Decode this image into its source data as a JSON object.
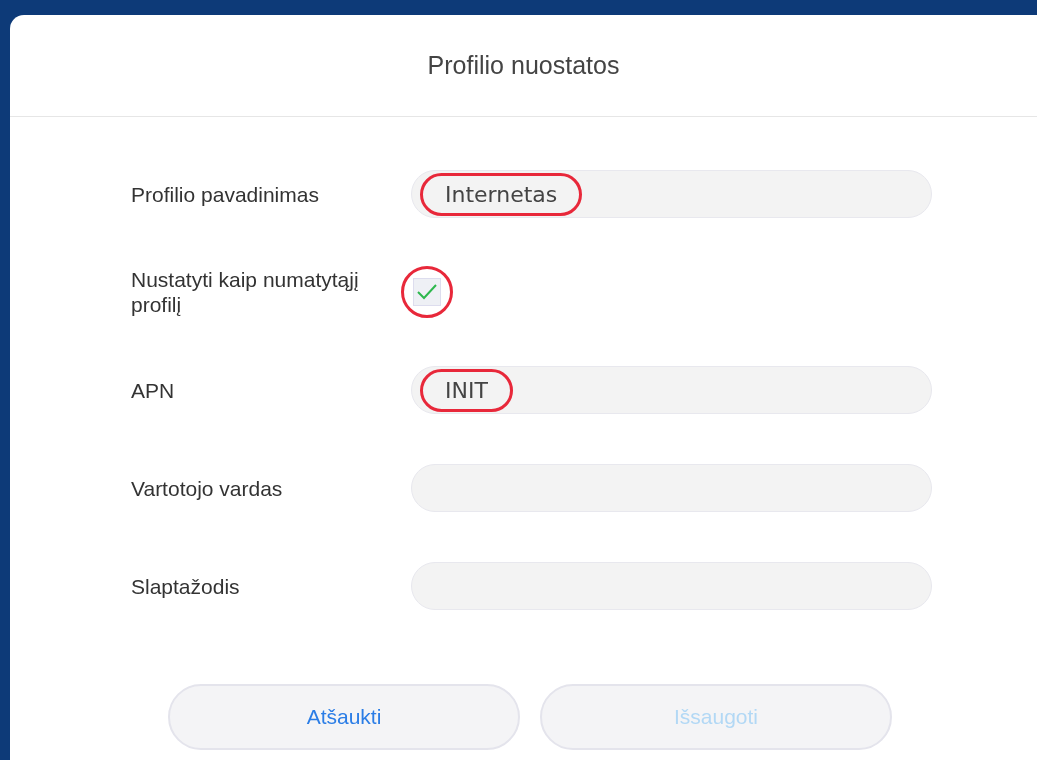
{
  "dialog": {
    "title": "Profilio nuostatos"
  },
  "fields": [
    {
      "kind": "text",
      "label": "Profilio pavadinimas",
      "value": "Internetas",
      "highlighted": true
    },
    {
      "kind": "checkbox",
      "label": "Nustatyti kaip numatytąjį profilį",
      "checked": true,
      "highlighted": true
    },
    {
      "kind": "text",
      "label": "APN",
      "value": "INIT",
      "highlighted": true
    },
    {
      "kind": "text",
      "label": "Vartotojo vardas",
      "highlighted": false
    },
    {
      "kind": "text",
      "label": "Slaptažodis",
      "highlighted": false
    }
  ],
  "buttons": [
    {
      "label": "Atšaukti",
      "disabled": false
    },
    {
      "label": "Išsaugoti",
      "disabled": true
    }
  ]
}
